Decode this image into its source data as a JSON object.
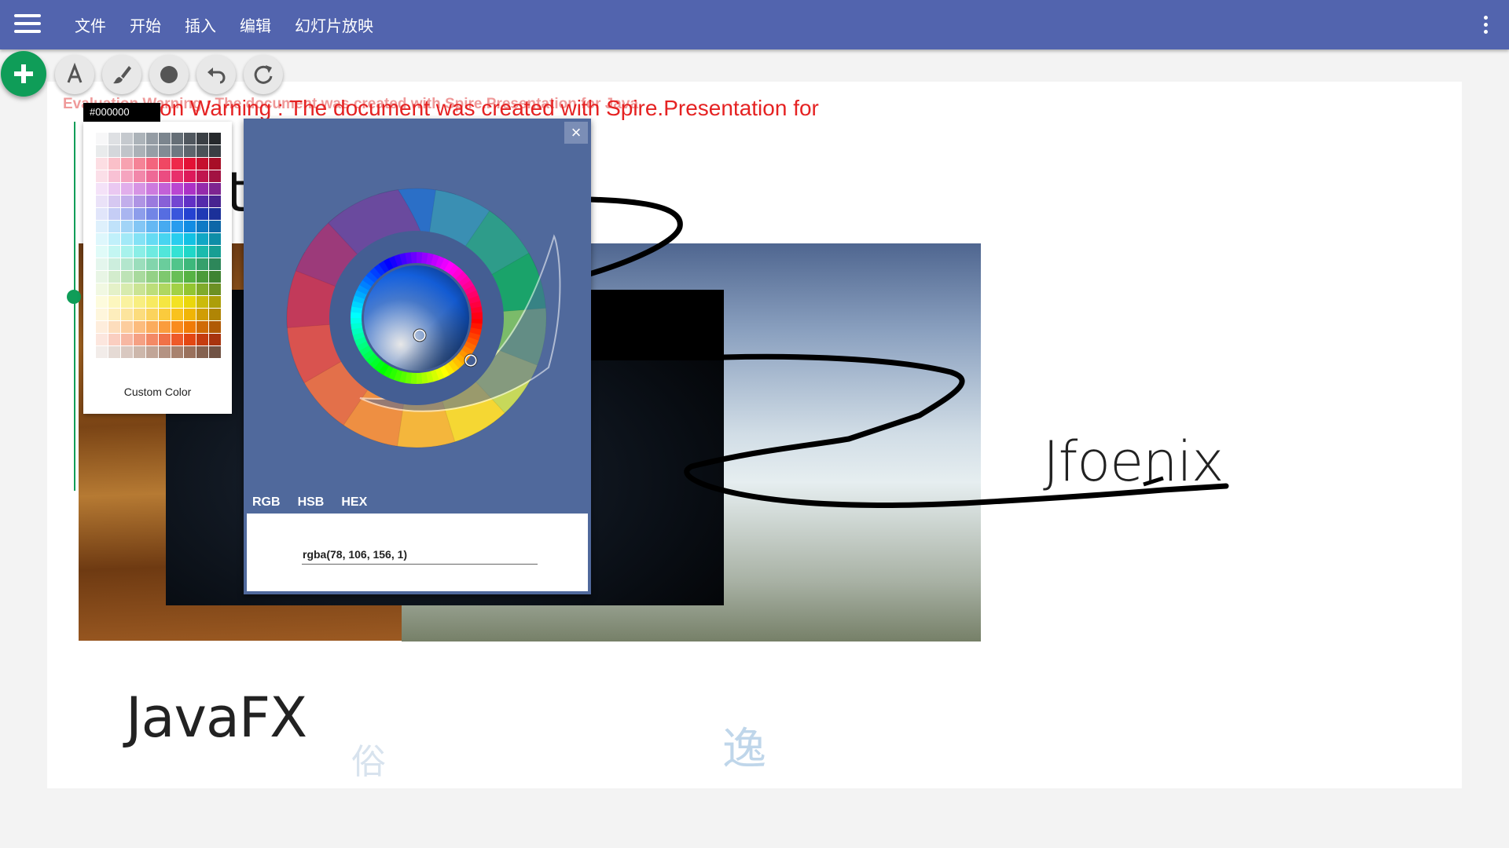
{
  "menu": {
    "items": [
      "文件",
      "开始",
      "插入",
      "编辑",
      "幻灯片放映"
    ]
  },
  "icons": {
    "menu": "hamburger-menu-icon",
    "more": "more-vert-icon",
    "add": "plus-icon",
    "text": "text-a-icon",
    "brush": "brush-icon",
    "shape": "circle-icon",
    "undo": "undo-icon",
    "redo": "redo-icon",
    "close": "close-icon"
  },
  "slide": {
    "eval_warning_faded": "Evaluation Warning : The document was created with  Spire.Presentation for Java",
    "eval_warning_main": "on Warning : The document was created with  Spire.Presentation for",
    "title_jfoenix": "Jfoenix",
    "title_javafx": "JavaFX",
    "partial_char": "t",
    "calligraphy_1": "逸",
    "calligraphy_2": "俗"
  },
  "palette": {
    "current_hex": "#000000",
    "custom_color_label": "Custom Color"
  },
  "picker": {
    "close_symbol": "×",
    "tabs": [
      "RGB",
      "HSB",
      "HEX"
    ],
    "active_tab": "RGB",
    "value": "rgba(78, 106, 156, 1)"
  },
  "colors": {
    "appbar": "#5264ae",
    "accent_green": "#0f9d58",
    "picker_bg": "#50699c",
    "warning_red": "#e52222"
  }
}
